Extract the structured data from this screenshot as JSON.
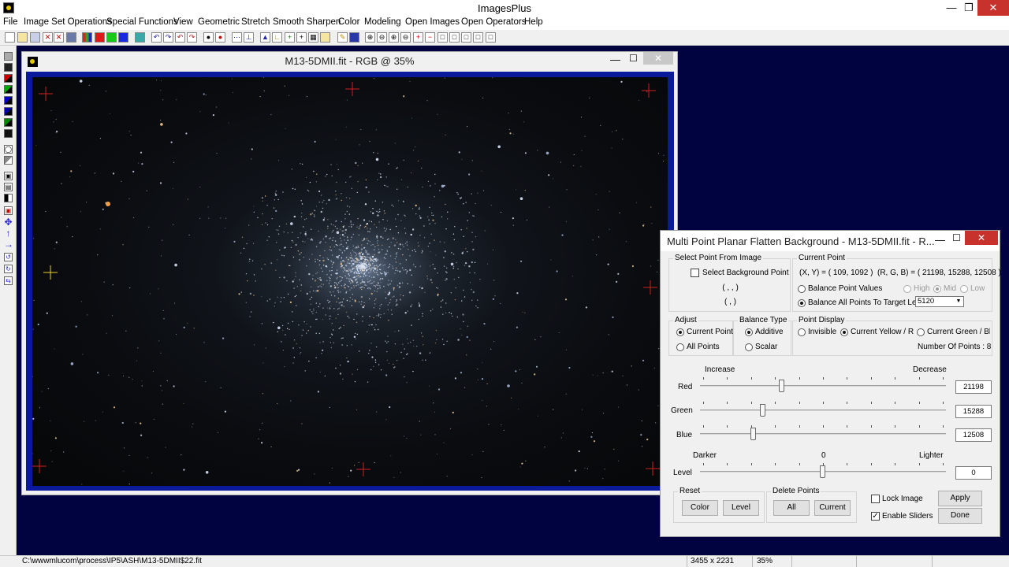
{
  "app": {
    "title": "ImagesPlus",
    "minimize": "—",
    "maximize": "❐",
    "close": "✕"
  },
  "menu": [
    {
      "label": "File",
      "name": "menu-file"
    },
    {
      "label": "Image Set Operations",
      "name": "menu-image-set-operations"
    },
    {
      "label": "Special Functions",
      "name": "menu-special-functions"
    },
    {
      "label": "View",
      "name": "menu-view"
    },
    {
      "label": "Geometric",
      "name": "menu-geometric"
    },
    {
      "label": "Stretch",
      "name": "menu-stretch"
    },
    {
      "label": "Smooth Sharpen",
      "name": "menu-smooth-sharpen"
    },
    {
      "label": "Color",
      "name": "menu-color"
    },
    {
      "label": "Modeling",
      "name": "menu-modeling"
    },
    {
      "label": "Open Images",
      "name": "menu-open-images"
    },
    {
      "label": "Open Operators",
      "name": "menu-open-operators"
    },
    {
      "label": "Help",
      "name": "menu-help"
    }
  ],
  "image_window": {
    "title": "M13-5DMII.fit - RGB @ 35%",
    "minimize": "—",
    "maximize": "☐",
    "close": "✕"
  },
  "dialog": {
    "title": "Multi Point Planar Flatten Background - M13-5DMII.fit - R...",
    "minimize": "—",
    "maximize": "☐",
    "close": "✕",
    "select_point": {
      "group_label": "Select Point From Image",
      "checkbox_label": "Select Background Point",
      "coord_line1": "( , , )",
      "coord_line2": "( , )"
    },
    "current_point": {
      "group_label": "Current Point",
      "xy": "(X, Y) = ( 109, 1092 )",
      "rgb": "(R, G, B) = ( 21198, 15288, 12508 )",
      "balance_point_values": "Balance Point Values",
      "high": "High",
      "mid": "Mid",
      "low": "Low",
      "balance_all": "Balance All Points To Target Level",
      "target_level": "5120",
      "dropdown_arrow": "▼"
    },
    "adjust": {
      "group_label": "Adjust",
      "current_point": "Current Point",
      "all_points": "All Points"
    },
    "balance_type": {
      "group_label": "Balance Type",
      "additive": "Additive",
      "scalar": "Scalar"
    },
    "point_display": {
      "group_label": "Point Display",
      "invisible": "Invisible",
      "current_yellow": "Current Yellow / Red",
      "current_green": "Current Green / Blue",
      "number_of_points": "Number Of Points : 8"
    },
    "sliders": {
      "increase": "Increase",
      "decrease": "Decrease",
      "darker": "Darker",
      "zero": "0",
      "lighter": "Lighter",
      "red_label": "Red",
      "red_value": "21198",
      "red_pos": 0.33,
      "green_label": "Green",
      "green_value": "15288",
      "green_pos": 0.25,
      "blue_label": "Blue",
      "blue_value": "12508",
      "blue_pos": 0.21,
      "level_label": "Level",
      "level_value": "0",
      "level_pos": 0.5
    },
    "reset": {
      "group_label": "Reset",
      "color": "Color",
      "level": "Level"
    },
    "delete_points": {
      "group_label": "Delete Points",
      "all": "All",
      "current": "Current"
    },
    "lock_image": "Lock Image",
    "enable_sliders": "Enable Sliders",
    "checkmark": "✓",
    "apply": "Apply",
    "done": "Done"
  },
  "status": {
    "path": "C:\\wwwmlucom\\process\\IP5\\ASH\\M13-5DMII$22.fit",
    "dimensions": "3455 x 2231",
    "zoom": "35%"
  }
}
